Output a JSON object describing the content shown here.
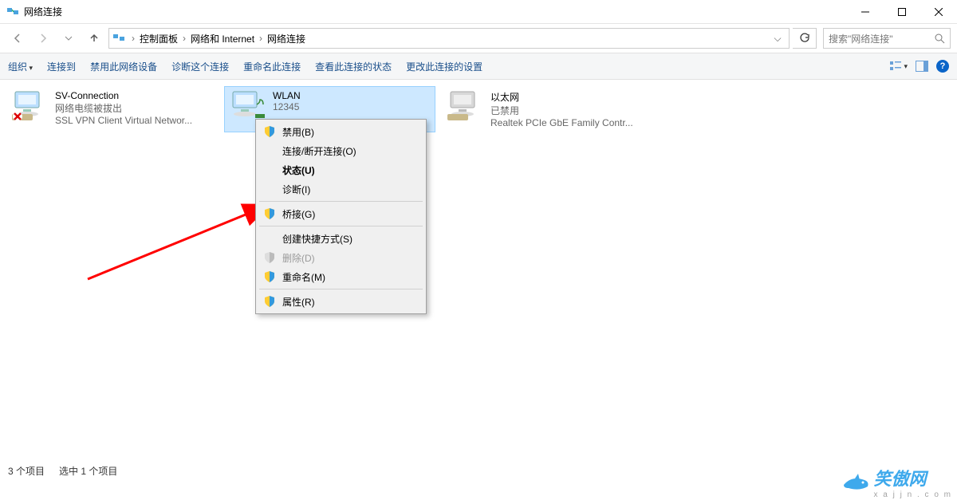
{
  "titlebar": {
    "title": "网络连接"
  },
  "breadcrumb": {
    "items": [
      "控制面板",
      "网络和 Internet",
      "网络连接"
    ]
  },
  "search": {
    "placeholder": "搜索\"网络连接\""
  },
  "cmdbar": {
    "organize": "组织",
    "connect_to": "连接到",
    "disable": "禁用此网络设备",
    "diagnose": "诊断这个连接",
    "rename": "重命名此连接",
    "view_status": "查看此连接的状态",
    "change_settings": "更改此连接的设置"
  },
  "connections": [
    {
      "name": "SV-Connection",
      "status": "网络电缆被拔出",
      "device": "SSL VPN Client Virtual Networ...",
      "selected": false,
      "disconnected": true
    },
    {
      "name": "WLAN",
      "status": "12345",
      "device": "",
      "selected": true,
      "disconnected": false
    },
    {
      "name": "以太网",
      "status": "已禁用",
      "device": "Realtek PCIe GbE Family Contr...",
      "selected": false,
      "disconnected": false
    }
  ],
  "context_menu": [
    {
      "label": "禁用(B)",
      "shield": true,
      "bold": false,
      "disabled": false
    },
    {
      "label": "连接/断开连接(O)",
      "shield": false,
      "bold": false,
      "disabled": false
    },
    {
      "label": "状态(U)",
      "shield": false,
      "bold": true,
      "disabled": false
    },
    {
      "label": "诊断(I)",
      "shield": false,
      "bold": false,
      "disabled": false
    },
    {
      "sep": true
    },
    {
      "label": "桥接(G)",
      "shield": true,
      "bold": false,
      "disabled": false
    },
    {
      "sep": true
    },
    {
      "label": "创建快捷方式(S)",
      "shield": false,
      "bold": false,
      "disabled": false
    },
    {
      "label": "删除(D)",
      "shield": true,
      "bold": false,
      "disabled": true
    },
    {
      "label": "重命名(M)",
      "shield": true,
      "bold": false,
      "disabled": false
    },
    {
      "sep": true
    },
    {
      "label": "属性(R)",
      "shield": true,
      "bold": false,
      "disabled": false
    }
  ],
  "statusbar": {
    "count": "3 个项目",
    "selected": "选中 1 个项目"
  },
  "watermark": {
    "brand": "笑傲网",
    "url": "x a j j n . c o m"
  }
}
